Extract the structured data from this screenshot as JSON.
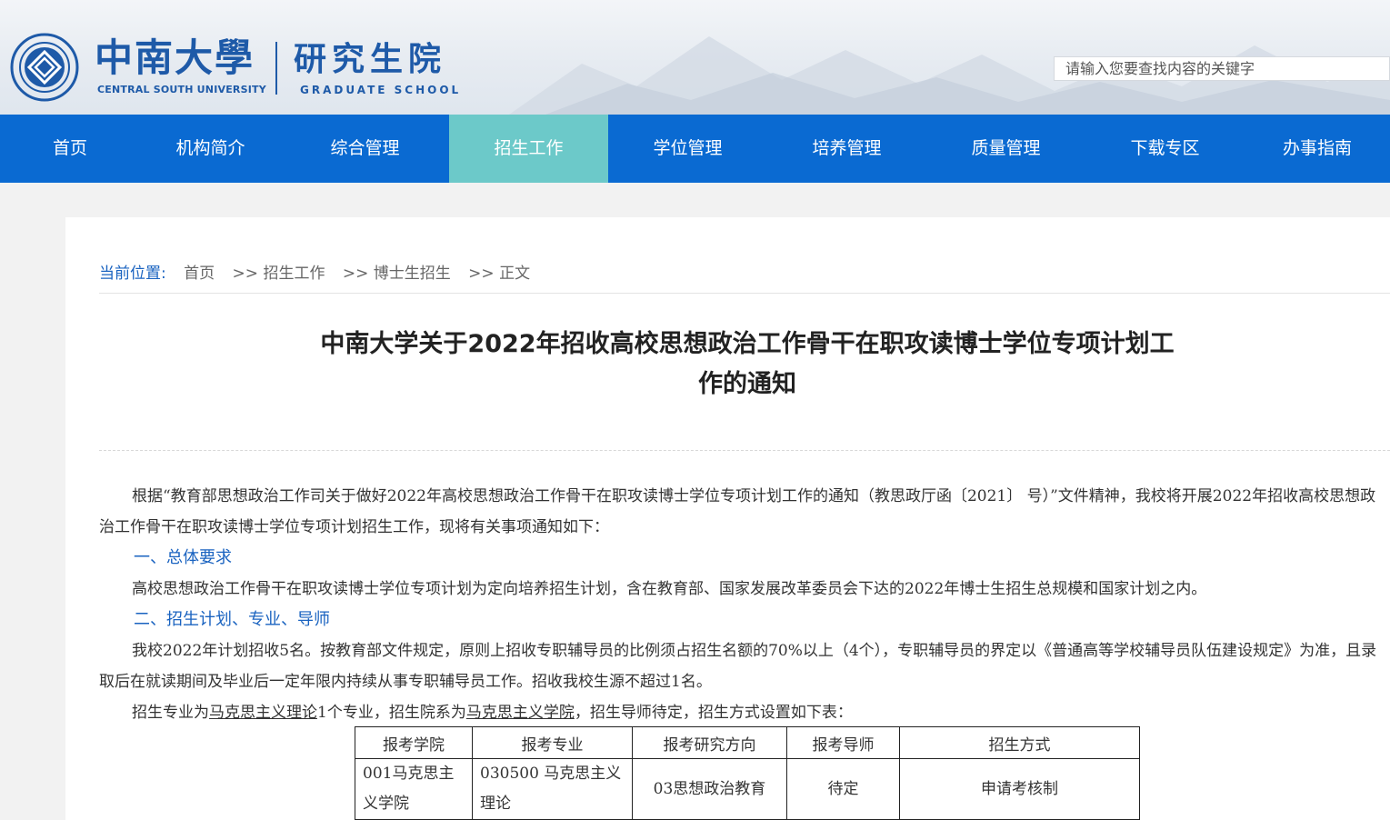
{
  "header": {
    "logo_cn": "中南大學",
    "logo_en": "CENTRAL SOUTH UNIVERSITY",
    "school_cn": "研究生院",
    "school_en": "GRADUATE SCHOOL",
    "search_placeholder": "请输入您要查找内容的关键字"
  },
  "nav": [
    {
      "label": "首页"
    },
    {
      "label": "机构简介"
    },
    {
      "label": "综合管理"
    },
    {
      "label": "招生工作",
      "active": true
    },
    {
      "label": "学位管理"
    },
    {
      "label": "培养管理"
    },
    {
      "label": "质量管理"
    },
    {
      "label": "下载专区"
    },
    {
      "label": "办事指南"
    }
  ],
  "breadcrumb": {
    "label": "当前位置:",
    "items": [
      "首页",
      "招生工作",
      "博士生招生",
      "正文"
    ],
    "separator": ">>"
  },
  "article": {
    "title_line1": "中南大学关于2022年招收高校思想政治工作骨干在职攻读博士学位专项计划工",
    "title_line2": "作的通知",
    "p1": "根据“教育部思想政治工作司关于做好2022年高校思想政治工作骨干在职攻读博士学位专项计划工作的通知（教思政厅函〔2021〕 号）”文件精神，我校将开展2022年招收高校思想政治工作骨干在职攻读博士学位专项计划招生工作，现将有关事项通知如下：",
    "h1": "一、总体要求",
    "p2": "高校思想政治工作骨干在职攻读博士学位专项计划为定向培养招生计划，含在教育部、国家发展改革委员会下达的2022年博士生招生总规模和国家计划之内。",
    "h2": "二、招生计划、专业、导师",
    "p3": "我校2022年计划招收5名。按教育部文件规定，原则上招收专职辅导员的比例须占招生名额的70%以上（4个），专职辅导员的界定以《普通高等学校辅导员队伍建设规定》为准，且录取后在就读期间及毕业后一定年限内持续从事专职辅导员工作。招收我校生源不超过1名。",
    "p4_a": "招生专业为",
    "p4_major": "马克思主义理论",
    "p4_b": "1个专业，招生院系为",
    "p4_school": "马克思主义学院",
    "p4_c": "，招生导师待定，招生方式设置如下表："
  },
  "table": {
    "headers": [
      "报考学院",
      "报考专业",
      "报考研究方向",
      "报考导师",
      "招生方式"
    ],
    "rows": [
      [
        "001马克思主义学院",
        "030500 马克思主义理论",
        "03思想政治教育",
        "待定",
        "申请考核制"
      ]
    ]
  }
}
